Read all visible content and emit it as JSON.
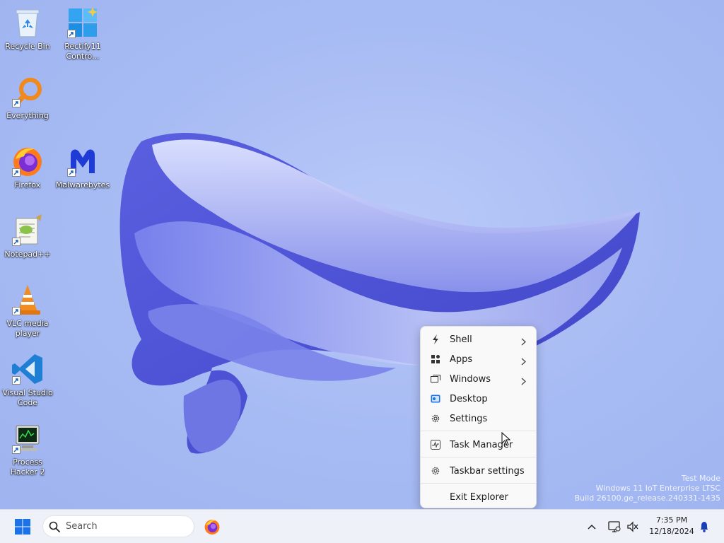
{
  "desktop_icons": [
    {
      "label": "Recycle Bin",
      "icon": "recycle-bin-icon"
    },
    {
      "label": "Rectify11 Contro...",
      "icon": "rectify11-control-panel-icon"
    },
    {
      "label": "Everything",
      "icon": "everything-search-icon"
    },
    {
      "label": "Firefox",
      "icon": "firefox-icon"
    },
    {
      "label": "Malwarebytes",
      "icon": "malwarebytes-icon"
    },
    {
      "label": "Notepad++",
      "icon": "notepad-plus-plus-icon"
    },
    {
      "label": "VLC media player",
      "icon": "vlc-icon"
    },
    {
      "label": "Visual Studio Code",
      "icon": "vscode-icon"
    },
    {
      "label": "Process Hacker 2",
      "icon": "process-hacker-icon"
    }
  ],
  "context_menu": {
    "items": [
      {
        "label": "Shell",
        "icon": "shell-icon",
        "submenu": true
      },
      {
        "label": "Apps",
        "icon": "apps-grid-icon",
        "submenu": true
      },
      {
        "label": "Windows",
        "icon": "windows-icon",
        "submenu": true
      },
      {
        "label": "Desktop",
        "icon": "desktop-icon",
        "submenu": false
      },
      {
        "label": "Settings",
        "icon": "gear-icon",
        "submenu": false
      },
      {
        "label": "Task Manager",
        "icon": "task-manager-icon",
        "submenu": false
      },
      {
        "label": "Taskbar settings",
        "icon": "gear-icon",
        "submenu": false
      },
      {
        "label": "Exit Explorer",
        "icon": "",
        "submenu": false
      }
    ]
  },
  "watermark": {
    "line1": "Test Mode",
    "line2": "Windows 11 IoT Enterprise LTSC",
    "line3": "Build 26100.ge_release.240331-1435"
  },
  "taskbar": {
    "search_placeholder": "Search",
    "pinned_apps": [
      "firefox-icon"
    ],
    "tray_icons": [
      "chevron-up-icon",
      "network-icon",
      "volume-muted-icon",
      "bell-icon"
    ],
    "clock_time": "7:35 PM",
    "clock_date": "12/18/2024"
  },
  "colors": {
    "accent": "#1a73e8",
    "desktop_bg": "#a8bcf3",
    "taskbar_bg": "#eef1f8"
  }
}
